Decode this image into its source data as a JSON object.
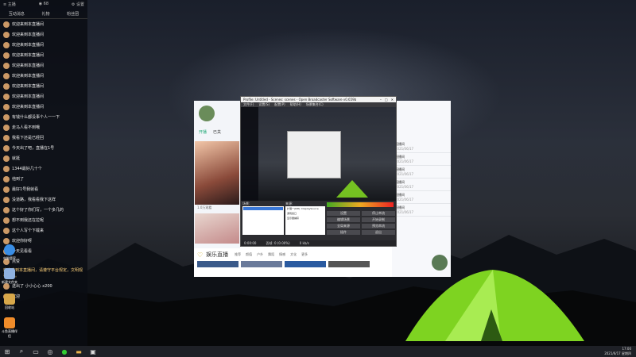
{
  "chat": {
    "tabs": [
      "互动消息",
      "礼物",
      "粉丝团"
    ],
    "top_left": "≡ 主播",
    "top_mid": "◉ 68",
    "top_right": "⚙ 设置",
    "messages": [
      {
        "name": "",
        "text": "欢迎来到本直播间"
      },
      {
        "name": "",
        "text": "欢迎来到本直播间"
      },
      {
        "name": "",
        "text": "欢迎来到本直播间"
      },
      {
        "name": "",
        "text": "欢迎来到本直播间"
      },
      {
        "name": "",
        "text": "欢迎来到本直播间"
      },
      {
        "name": "",
        "text": "欢迎来到本直播间"
      },
      {
        "name": "",
        "text": "欢迎来到本直播间"
      },
      {
        "name": "",
        "text": "欢迎来到本直播间"
      },
      {
        "name": "",
        "text": "欢迎来到本直播间"
      },
      {
        "name": "",
        "text": "有钱什么都没事个人一一下"
      },
      {
        "name": "",
        "text": "走马人看不到哦"
      },
      {
        "name": "",
        "text": "我看下还是已经回"
      },
      {
        "name": "",
        "text": "今天出了吧，直播在1号"
      },
      {
        "name": "",
        "text": "就挺"
      },
      {
        "name": "",
        "text": "1344最好几十个"
      },
      {
        "name": "",
        "text": "他到了"
      },
      {
        "name": "",
        "text": "最好1号我就看"
      },
      {
        "name": "",
        "text": "没道路，我看看我下这样"
      },
      {
        "name": "",
        "text": "这个好了你们写，一个多几的"
      },
      {
        "name": "",
        "text": "想不到我还在拉呢"
      },
      {
        "name": "",
        "text": "这个人写个下载来"
      },
      {
        "name": "",
        "text": "欢迎你好呀"
      },
      {
        "name": "",
        "text": "今天见看看"
      },
      {
        "name": "",
        "text": "点赞"
      }
    ],
    "system_notice": "欢迎来到本直播间，请遵守平台规定，文明观看直播。",
    "gift_line": "送出了 小小心心 x200",
    "last_line": "欢迎"
  },
  "desktop_icons": [
    {
      "label": "电脑管家",
      "color": "#3a8ee6"
    },
    {
      "label": "新建文件夹",
      "color": "#8fb1e0"
    },
    {
      "label": "回收站",
      "color": "#d8a84a"
    },
    {
      "label": "斗鱼直播伴侣",
      "color": "#f08c2a"
    }
  ],
  "stream_window": {
    "tabs": [
      "开播",
      "已关"
    ],
    "viewers": "1.0万观看",
    "entertainment_title": "娱乐直播",
    "entertainment_tabs": [
      "推荐",
      "颜值",
      "户外",
      "舞蹈",
      "情感",
      "文化",
      "更多"
    ],
    "right_items": [
      {
        "title": "直播间",
        "date": "2021/06/17"
      },
      {
        "title": "直播间",
        "date": "2021/06/17"
      },
      {
        "title": "直播间",
        "date": "2021/06/17"
      },
      {
        "title": "直播间",
        "date": "2021/06/17"
      },
      {
        "title": "直播间",
        "date": "2021/06/17"
      },
      {
        "title": "直播间",
        "date": "2021/06/17"
      }
    ]
  },
  "obs": {
    "title": "Profile: Untitled - Scenes: scenes - Open Broadcaster Software v0.659b",
    "menu": [
      "文件(F)",
      "设置(S)",
      "配置(P)",
      "帮助(H)",
      "场景集合(C)"
    ],
    "scenes_label": "场景:",
    "sources_label": "来源:",
    "sources": [
      "扩展一(DPI): DisplaySource",
      "游戏窗口",
      "显示器捕获"
    ],
    "buttons": [
      "设置",
      "停止串流",
      "编辑场景",
      "开始录制",
      "全局来源",
      "预览串流",
      "插件",
      "退出"
    ],
    "status": [
      "0:00:00",
      "丢帧: 0 (0.00%)",
      "0 kb/s"
    ]
  },
  "taskbar": {
    "time": "17:00",
    "date": "2021/6/17 星期四"
  }
}
